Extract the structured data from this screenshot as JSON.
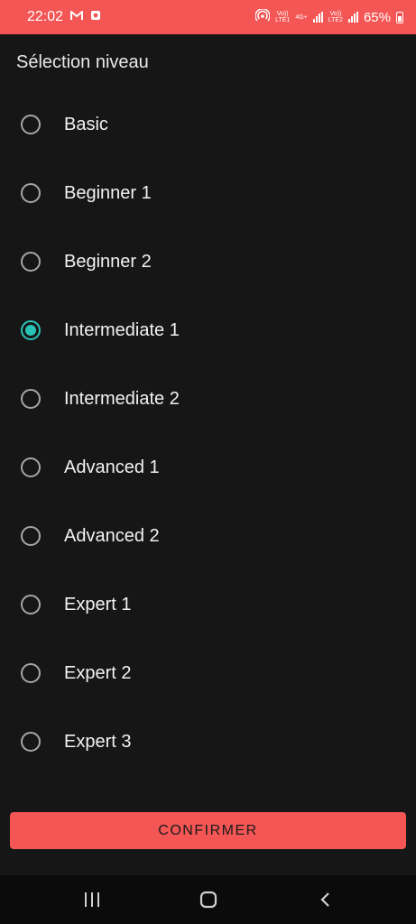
{
  "status_bar": {
    "time": "22:02",
    "left_icons": [
      "gmail-icon",
      "notification-icon"
    ],
    "right_icons": [
      "hotspot-icon",
      "signal-1-icon",
      "signal-2-icon",
      "battery-icon"
    ],
    "sim1_top": "Vo))",
    "sim1_bottom": "LTE1",
    "network_type": "4G+",
    "sim2_top": "Vo))",
    "sim2_bottom": "LTE2",
    "battery": "65%",
    "color": "#f35654"
  },
  "page": {
    "title": "Sélection niveau"
  },
  "levels": {
    "selected": "Intermediate 1",
    "accent_color": "#27c4b5",
    "options": [
      {
        "label": "Basic",
        "checked": false
      },
      {
        "label": "Beginner 1",
        "checked": false
      },
      {
        "label": "Beginner 2",
        "checked": false
      },
      {
        "label": "Intermediate 1",
        "checked": true
      },
      {
        "label": "Intermediate 2",
        "checked": false
      },
      {
        "label": "Advanced 1",
        "checked": false
      },
      {
        "label": "Advanced 2",
        "checked": false
      },
      {
        "label": "Expert 1",
        "checked": false
      },
      {
        "label": "Expert 2",
        "checked": false
      },
      {
        "label": "Expert 3",
        "checked": false
      }
    ]
  },
  "actions": {
    "confirm_label": "CONFIRMER",
    "confirm_color": "#f35654"
  },
  "nav_bar": {
    "icons": [
      "recent-apps-icon",
      "home-icon",
      "back-icon"
    ]
  }
}
